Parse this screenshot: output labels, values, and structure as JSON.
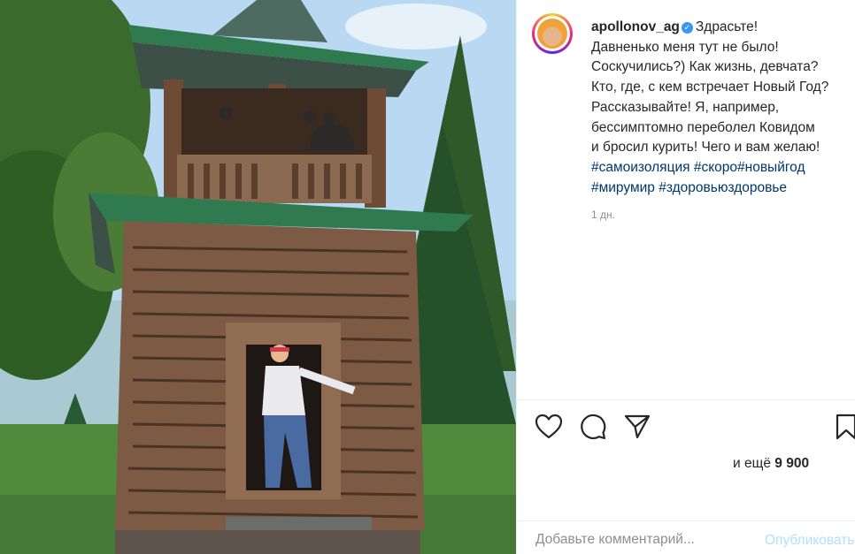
{
  "post": {
    "username": "apollonov_ag",
    "verified": true,
    "caption_lines": [
      "Здрасьте!",
      "Давненько меня тут не было!",
      "Соскучились?) Как жизнь, девчата?",
      "Кто, где, с кем встречает Новый Год?",
      "Рассказывайте! Я, например,",
      "бессимптомно переболел Ковидом",
      "и бросил курить! Чего и вам желаю!"
    ],
    "hashtags": [
      "#самоизоляция",
      "#скоро#новыйгод",
      "#мирумир",
      "#здоровьюздоровье"
    ],
    "timestamp": "1 дн."
  },
  "actions": {
    "icons": [
      "heart-icon",
      "comment-icon",
      "share-icon",
      "bookmark-icon"
    ]
  },
  "likes": {
    "prefix": "и ещё",
    "count": "9 900"
  },
  "comment_box": {
    "placeholder": "Добавьте комментарий...",
    "publish_label": "Опубликовать"
  },
  "colors": {
    "link": "#00376b",
    "verified": "#3897f0",
    "publish_disabled": "#b2dffc",
    "muted": "#8e8e8e",
    "roof_green": "#2f7a4f"
  }
}
